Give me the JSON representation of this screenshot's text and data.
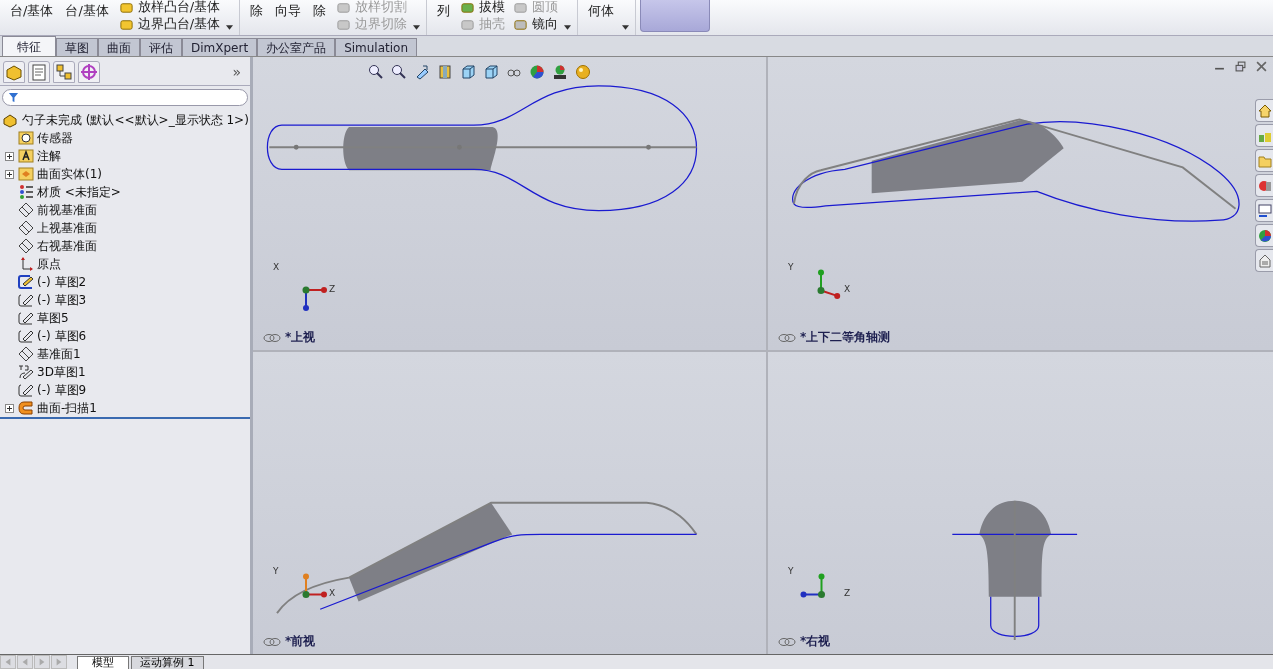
{
  "toolbar": [
    {
      "items": [
        {
          "kind": "large",
          "label": "台/基体"
        },
        {
          "kind": "large",
          "label": "台/基体"
        },
        {
          "kind": "stack",
          "items": [
            {
              "label": "放样凸台/基体",
              "disabled": false
            },
            {
              "label": "边界凸台/基体",
              "disabled": false
            }
          ]
        }
      ]
    },
    {
      "items": [
        {
          "kind": "large",
          "label": "除"
        },
        {
          "kind": "large",
          "label": "向导"
        },
        {
          "kind": "large",
          "label": "除"
        },
        {
          "kind": "stack",
          "items": [
            {
              "label": "放样切割",
              "disabled": true
            },
            {
              "label": "边界切除",
              "disabled": true
            }
          ]
        }
      ]
    },
    {
      "items": [
        {
          "kind": "large",
          "label": "列"
        },
        {
          "kind": "stack",
          "items": [
            {
              "label": "拔模",
              "disabled": false
            },
            {
              "label": "抽壳",
              "disabled": true
            }
          ]
        },
        {
          "kind": "stack",
          "items": [
            {
              "label": "圆顶",
              "disabled": true
            },
            {
              "label": "镜向",
              "disabled": false
            }
          ]
        }
      ]
    },
    {
      "items": [
        {
          "kind": "large",
          "label": "何体"
        }
      ]
    }
  ],
  "tabs": [
    {
      "label": "特征",
      "selected": true
    },
    {
      "label": "草图",
      "selected": false
    },
    {
      "label": "曲面",
      "selected": false
    },
    {
      "label": "评估",
      "selected": false
    },
    {
      "label": "DimXpert",
      "selected": false
    },
    {
      "label": "办公室产品",
      "selected": false
    },
    {
      "label": "Simulation",
      "selected": false
    }
  ],
  "feature_tree": {
    "root": {
      "label": "勺子未完成  (默认<<默认>_显示状态 1>)",
      "children": [
        {
          "label": "传感器",
          "kind": "sensor",
          "expandable": false
        },
        {
          "label": "注解",
          "kind": "annotation",
          "expandable": true
        },
        {
          "label": "曲面实体(1)",
          "kind": "surface-folder",
          "expandable": true
        },
        {
          "label": "材质 <未指定>",
          "kind": "material",
          "expandable": false
        },
        {
          "label": "前视基准面",
          "kind": "plane",
          "expandable": false
        },
        {
          "label": "上视基准面",
          "kind": "plane",
          "expandable": false
        },
        {
          "label": "右视基准面",
          "kind": "plane",
          "expandable": false
        },
        {
          "label": "原点",
          "kind": "origin",
          "expandable": false
        },
        {
          "label": "(-) 草图2",
          "kind": "sketch-edit",
          "expandable": false
        },
        {
          "label": "(-) 草图3",
          "kind": "sketch",
          "expandable": false
        },
        {
          "label": "草图5",
          "kind": "sketch",
          "expandable": false
        },
        {
          "label": "(-) 草图6",
          "kind": "sketch",
          "expandable": false
        },
        {
          "label": "基准面1",
          "kind": "plane",
          "expandable": false
        },
        {
          "label": "3D草图1",
          "kind": "sketch3d",
          "expandable": false
        },
        {
          "label": "(-) 草图9",
          "kind": "sketch",
          "expandable": false
        },
        {
          "label": "曲面-扫描1",
          "kind": "sweep",
          "expandable": true
        }
      ]
    }
  },
  "panel_more": "»",
  "viewports": [
    {
      "label": "*上视",
      "axes": [
        "X",
        "Z"
      ]
    },
    {
      "label": "*上下二等角轴测",
      "axes": [
        "Y",
        "X"
      ]
    },
    {
      "label": "*前视",
      "axes": [
        "Y",
        "X"
      ]
    },
    {
      "label": "*右视",
      "axes": [
        "Y",
        "Z"
      ]
    }
  ],
  "bottom_tabs": [
    {
      "label": "模型",
      "selected": true
    },
    {
      "label": "运动算例 1",
      "selected": false
    }
  ]
}
